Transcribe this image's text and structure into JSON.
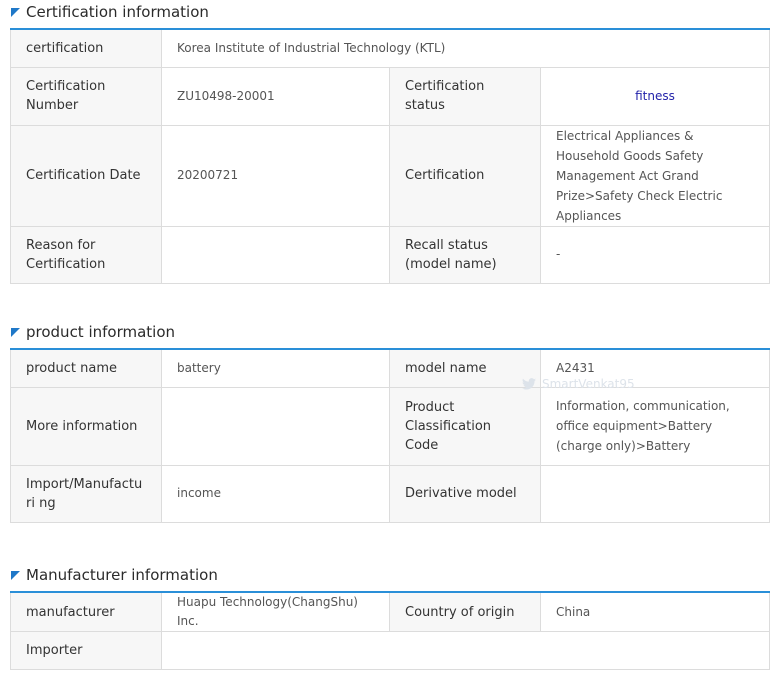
{
  "sections": {
    "certification": {
      "title": "Certification information",
      "certification_label": "certification",
      "certification_value": "Korea Institute of Industrial Technology (KTL)",
      "number_label": "Certification Number",
      "number_value": "ZU10498-20001",
      "status_label": "Certification status",
      "status_value": "fitness",
      "date_label": "Certification Date",
      "date_value": "20200721",
      "cert_label": "Certification",
      "cert_value": "Electrical Appliances & Household Goods Safety Management Act Grand Prize>Safety Check Electric Appliances",
      "reason_label": "Reason for Certification",
      "reason_value": "",
      "recall_label": "Recall status (model name)",
      "recall_value": "-"
    },
    "product": {
      "title": "product information",
      "name_label": "product name",
      "name_value": "battery",
      "model_label": "model name",
      "model_value": "A2431",
      "more_label": "More information",
      "more_value": "",
      "class_label": "Product Classification Code",
      "class_value": "Information, communication, office equipment>Battery (charge only)>Battery",
      "import_label": "Import/Manufacturi ng",
      "import_value": "income",
      "derivative_label": "Derivative model",
      "derivative_value": ""
    },
    "manufacturer": {
      "title": "Manufacturer information",
      "manufacturer_label": "manufacturer",
      "manufacturer_value": "Huapu Technology(ChangShu) Inc.",
      "country_label": "Country of origin",
      "country_value": "China",
      "importer_label": "Importer",
      "importer_value": ""
    }
  },
  "watermark": {
    "text": "SmartVenkat95",
    "icon": "twitter-bird-icon"
  },
  "colors": {
    "accent": "#2a8fd8",
    "flag": "#1f78c8",
    "status": "#2222aa",
    "header_bg": "#f7f7f7"
  }
}
